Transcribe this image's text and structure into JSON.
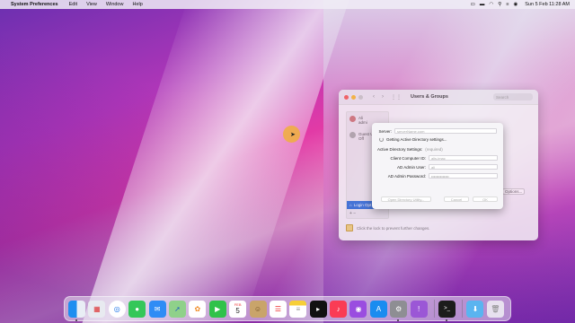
{
  "menubar": {
    "app_name": "System Preferences",
    "menus": [
      "Edit",
      "View",
      "Window",
      "Help"
    ],
    "clock": "Sun 5 Feb  11:28 AM"
  },
  "prefs_window": {
    "title": "Users & Groups",
    "search_placeholder": "Search",
    "sidebar": {
      "user1": "Ali\nadmi",
      "user2": "Guest U\nOff",
      "login_options": "Login Opt",
      "add_remove": "+ −"
    },
    "options_button": "Options...",
    "lock_text": "Click the lock to prevent further changes."
  },
  "ad_sheet": {
    "server_label": "Server:",
    "server_placeholder": "serverName.com",
    "status": "Getting Active Directory settings...",
    "ad_settings_label": "Active Directory Settings:",
    "ad_settings_value": "(required)",
    "client_id_label": "Client Computer ID:",
    "client_id_value": "alis-imac",
    "admin_user_label": "AD Admin User:",
    "admin_user_value": "ali",
    "admin_password_label": "AD Admin Password:",
    "admin_password_value": "••••••••••••••",
    "open_utility_button": "Open Directory Utility...",
    "cancel_button": "Cancel",
    "ok_button": "OK"
  },
  "dock": {
    "apps": [
      "finder",
      "launchpad",
      "safari",
      "messages",
      "mail",
      "maps",
      "photos",
      "facetime",
      "calendar",
      "contacts",
      "reminders",
      "notes",
      "tv",
      "music",
      "podcasts",
      "app-store",
      "system-preferences",
      "feedback",
      "terminal",
      "downloads",
      "trash"
    ],
    "calendar_month": "FEB",
    "calendar_day": "5"
  }
}
